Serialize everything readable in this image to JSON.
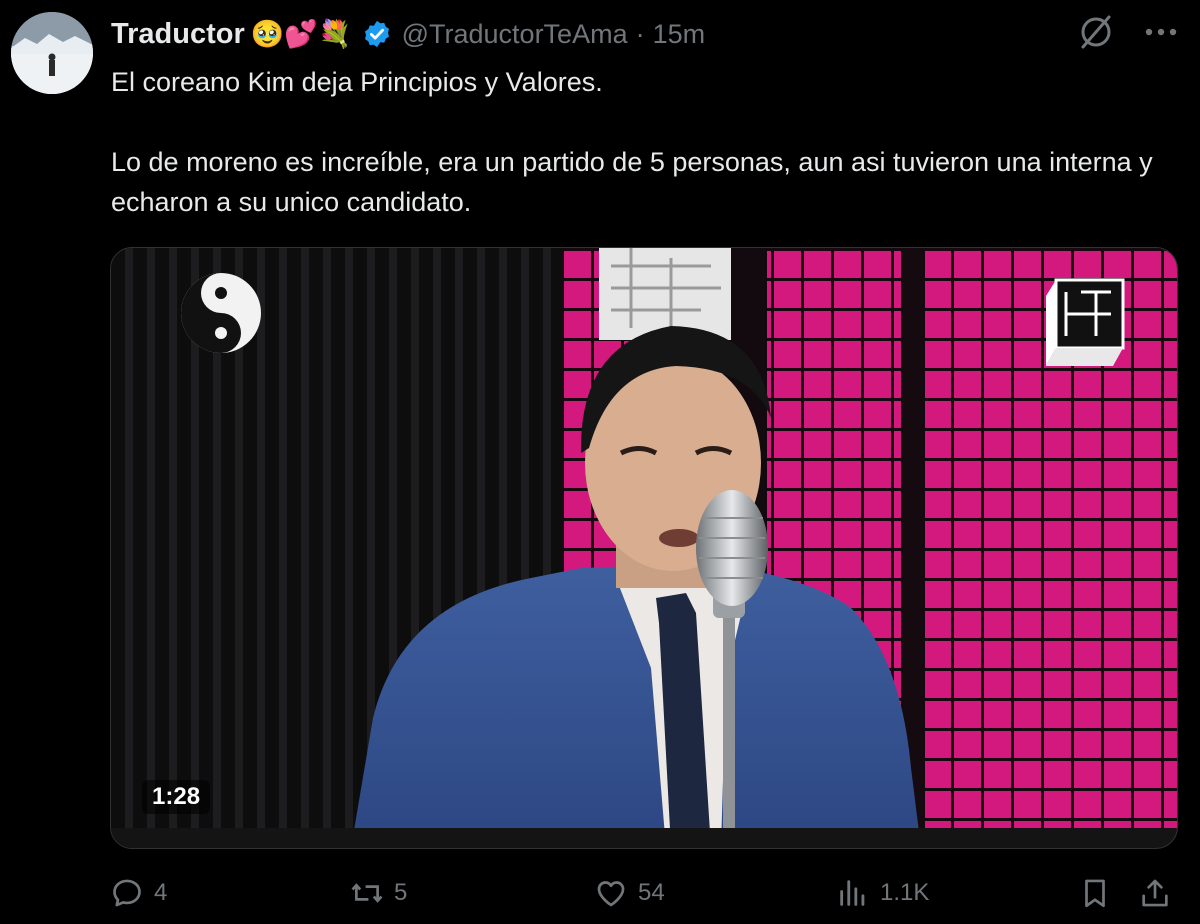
{
  "post": {
    "author": {
      "display_name": "Traductor",
      "emoji": "🥹💕💐",
      "handle": "@TraductorTeAma",
      "separator": "·",
      "time": "15m"
    },
    "text": {
      "paragraph1": "El coreano Kim deja Principios y Valores.",
      "paragraph2": "Lo de moreno es increíble, era un partido de 5 personas, aun asi tuvieron una interna y echaron a su unico candidato."
    },
    "media": {
      "duration": "1:28"
    },
    "stats": {
      "replies": "4",
      "reposts": "5",
      "likes": "54",
      "views": "1.1K"
    }
  },
  "colors": {
    "background": "#000000",
    "text": "#e7e9ea",
    "muted": "#71767b",
    "verified": "#1d9bf0",
    "wall_pink": "#d4197e"
  },
  "icons": [
    "grok-icon",
    "more-icon",
    "verified-badge-icon",
    "reply-icon",
    "repost-icon",
    "like-icon",
    "views-icon",
    "bookmark-icon",
    "share-icon"
  ]
}
